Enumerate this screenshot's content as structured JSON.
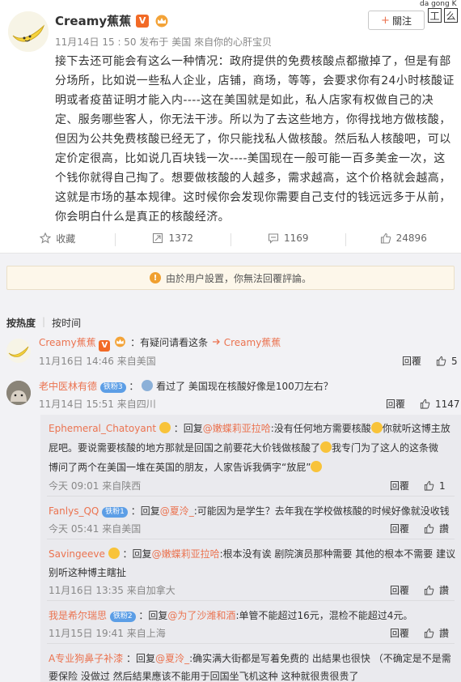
{
  "post": {
    "author": "Creamy蕉蕉",
    "verified_badge": "V",
    "meta_time": "11月14日 15 : 50",
    "meta_posted_from": "发布于",
    "meta_location": "美国",
    "meta_source": "來自你的心肝宝贝",
    "follow_label": "關注",
    "body": "接下去还可能会有这么一种情况：政府提供的免费核酸点都撤掉了，但是有部分场所，比如说一些私人企业，店铺，商场，等等，会要求你有24小时核酸证明或者疫苗证明才能入内----这在美国就是如此，私人店家有权做自己的决定、服务哪些客人，你无法干涉。所以为了去这些地方，你得找地方做核酸，但因为公共免费核酸已经无了，你只能找私人做核酸。然后私人核酸吧，可以定价定很高，比如说几百块钱一次----美国现在一般可能一百多美金一次，这个钱你就得自己掏了。想要做核酸的人越多，需求越高，这个价格就会越高，这就是市场的基本规律。这时候你会发现你需要自己支付的钱远远多于从前，你会明白什么是真正的核酸经济。"
  },
  "corner": {
    "text": "da gong K",
    "box1": "工",
    "box2": "么"
  },
  "actions": {
    "favorite": "收藏",
    "repost_count": "1372",
    "comment_count": "1169",
    "like_count": "24896"
  },
  "notice": "由於用户設置，你無法回覆評論。",
  "sort": {
    "by_heat": "按热度",
    "by_time": "按时间"
  },
  "comments": [
    {
      "name": "Creamy蕉蕉",
      "text": "：有疑问请看这条",
      "link": "Creamy蕉蕉",
      "time": "11月16日 14:46 来自美国",
      "reply": "回覆",
      "likes": "5"
    },
    {
      "name": "老中医林有德",
      "badge": "铁粉3",
      "text": "看过了 美国现在核酸好像是100刀左右？",
      "time": "11月14日 15:51 来自四川",
      "reply": "回覆",
      "likes": "1147"
    }
  ],
  "replies": [
    {
      "name": "Ephemeral_Chatoyant",
      "prefix": "：回复",
      "at": "@嫩蝶莉亚拉哈",
      "line1": ":没有任何地方需要核酸",
      "line1b": "你就听这博主放",
      "line2": "屁吧。要说需要核酸的地方那就是回国之前要花大价钱做核酸了",
      "line2b": "我专门为了这人的这条微",
      "line3": "博问了两个在美国一堆在英国的朋友，人家告诉我俩字“放屁”",
      "time": "今天 09:01 来自陕西",
      "reply": "回覆",
      "likes": "1"
    },
    {
      "name": "Fanlys_QQ",
      "badge": "铁粉1",
      "prefix": "：回复",
      "at": "@夏泠_",
      "line1": ":可能因为是学生？去年我在学校做核酸的时候好像就没收钱",
      "time": "今天 05:41 来自美国",
      "reply": "回覆",
      "likes": "讚"
    },
    {
      "name": "Savingeeve",
      "prefix": "：回复",
      "at": "@嫩蝶莉亚拉哈",
      "line1": ":根本没有诶 剧院演员那种需要 其他的根本不需要 建议",
      "line2": "别听这种博主瞎扯",
      "time": "11月16日 13:35 来自加拿大",
      "reply": "回覆",
      "likes": "讚"
    },
    {
      "name": "我是希尔瑞思",
      "badge": "铁粉2",
      "prefix": "：回复",
      "at": "@为了沙潍和酒",
      "line1": ":单管不能超过16元，混检不能超过4元。",
      "time": "11月15日 19:41 来自上海",
      "reply": "回覆",
      "likes": "讚"
    },
    {
      "name": "A专业狗鼻子补漆",
      "prefix": "：回复",
      "at": "@夏泠_",
      "line1": ":确实满大街都是写着免费的 出結果也很快 （不确定是不是需",
      "line2": "要保险 没做过 然后結果應该不能用于回国坐飞机这种 这种就很贵很贵了"
    }
  ]
}
